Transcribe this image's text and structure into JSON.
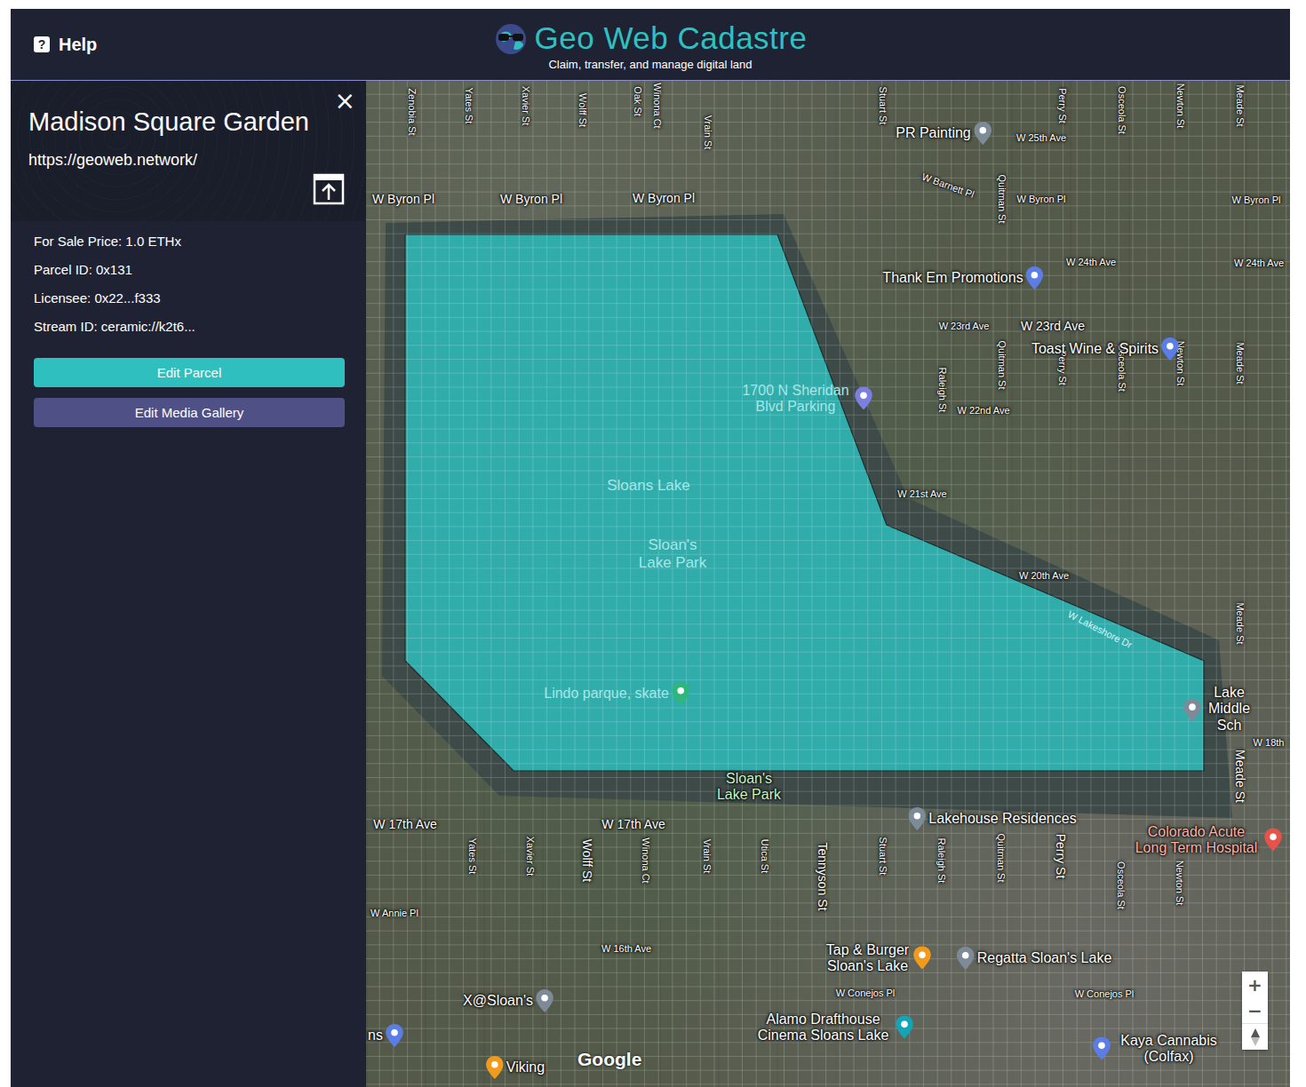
{
  "header": {
    "help": {
      "icon": "?",
      "label": "Help"
    },
    "logo": {
      "title": "Geo Web Cadastre",
      "subtitle": "Claim, transfer, and manage digital land"
    }
  },
  "panel": {
    "close": "×",
    "title": "Madison Square Garden",
    "url": "https://geoweb.network/",
    "fields": [
      {
        "label": "For Sale Price:",
        "value": "1.0 ETHx"
      },
      {
        "label": "Parcel ID:",
        "value": "0x131"
      },
      {
        "label": "Licensee:",
        "value": "0x22...f333"
      },
      {
        "label": "Stream ID:",
        "value": "ceramic://k2t6..."
      }
    ],
    "buttons": [
      {
        "label": "Edit Parcel",
        "kind": "primary"
      },
      {
        "label": "Edit Media Gallery",
        "kind": "secondary"
      }
    ]
  },
  "map": {
    "labels": [
      {
        "text": "Zenobia St",
        "kind": "street-v"
      },
      {
        "text": "Yates St",
        "kind": "street-v"
      },
      {
        "text": "Xavier St",
        "kind": "street-v"
      },
      {
        "text": "Wolff St",
        "kind": "street-v"
      },
      {
        "text": "Oak St",
        "kind": "street-v"
      },
      {
        "text": "Winona Ct",
        "kind": "street-v"
      },
      {
        "text": "Vrain St",
        "kind": "street-v"
      },
      {
        "text": "Stuart St",
        "kind": "street-v"
      },
      {
        "text": "Perry St",
        "kind": "street-v"
      },
      {
        "text": "Osceola St",
        "kind": "street-v"
      },
      {
        "text": "Newton St",
        "kind": "street-v"
      },
      {
        "text": "Meade St",
        "kind": "street-v"
      },
      {
        "text": "W Byron Pl",
        "kind": "street-big"
      },
      {
        "text": "W Byron Pl",
        "kind": "street-big"
      },
      {
        "text": "W Byron Pl",
        "kind": "street-big"
      },
      {
        "text": "W 25th Ave",
        "kind": "street"
      },
      {
        "text": "W Barnett Pl",
        "kind": "street"
      },
      {
        "text": "Quitman St",
        "kind": "street-v"
      },
      {
        "text": "W Byron Pl",
        "kind": "street"
      },
      {
        "text": "W Byron Pl",
        "kind": "street"
      },
      {
        "text": "W 24th Ave",
        "kind": "street"
      },
      {
        "text": "W 24th Ave",
        "kind": "street"
      },
      {
        "text": "W 23rd Ave",
        "kind": "street"
      },
      {
        "text": "W 23rd Ave",
        "kind": "street-big"
      },
      {
        "text": "Raleigh St",
        "kind": "street-v"
      },
      {
        "text": "Quitman St",
        "kind": "street-v"
      },
      {
        "text": "Perry St",
        "kind": "street-v"
      },
      {
        "text": "Osceola St",
        "kind": "street-v"
      },
      {
        "text": "Newton St",
        "kind": "street-v"
      },
      {
        "text": "Meade St",
        "kind": "street-v"
      },
      {
        "text": "W 22nd Ave",
        "kind": "street"
      },
      {
        "text": "W 21st Ave",
        "kind": "street"
      },
      {
        "text": "W 20th Ave",
        "kind": "street"
      },
      {
        "text": "W Lakeshore Dr",
        "kind": "street-faint"
      },
      {
        "text": "Meade St",
        "kind": "street-v"
      },
      {
        "text": "W 18th",
        "kind": "street"
      },
      {
        "text": "Meade St",
        "kind": "street-v-big"
      },
      {
        "text": "W 17th Ave",
        "kind": "street-big"
      },
      {
        "text": "W 17th Ave",
        "kind": "street-big"
      },
      {
        "text": "W Annie Pl",
        "kind": "street"
      },
      {
        "text": "W 16th Ave",
        "kind": "street"
      },
      {
        "text": "Yates St",
        "kind": "street-v"
      },
      {
        "text": "Xavier St",
        "kind": "street-v"
      },
      {
        "text": "Wolff St",
        "kind": "street-v-big"
      },
      {
        "text": "Winona Ct",
        "kind": "street-v"
      },
      {
        "text": "Vrain St",
        "kind": "street-v"
      },
      {
        "text": "Utica St",
        "kind": "street-v"
      },
      {
        "text": "Tennyson St",
        "kind": "street-v-big"
      },
      {
        "text": "Stuart St",
        "kind": "street-v"
      },
      {
        "text": "Raleigh St",
        "kind": "street-v"
      },
      {
        "text": "Quitman St",
        "kind": "street-v"
      },
      {
        "text": "Perry St",
        "kind": "street-v-big"
      },
      {
        "text": "Osceola St",
        "kind": "street-v"
      },
      {
        "text": "Newton St",
        "kind": "street-v"
      },
      {
        "text": "W Conejos Pl",
        "kind": "street"
      },
      {
        "text": "W Conejos Pl",
        "kind": "street"
      },
      {
        "text": "PR Painting",
        "kind": "poi",
        "color": "#7d8b98"
      },
      {
        "text": "Thank Em Promotions",
        "kind": "poi",
        "color": "#5b7de6"
      },
      {
        "text": "Toast Wine & Spirits",
        "kind": "poi",
        "color": "#5b7de6"
      },
      {
        "text": "1700 N Sheridan Blvd Parking",
        "kind": "poi-faint",
        "color": "#7b7fe0"
      },
      {
        "text": "Sloans Lake",
        "kind": "area"
      },
      {
        "text": "Sloan's Lake Park",
        "kind": "area"
      },
      {
        "text": "Lindo parque, skate",
        "kind": "poi-faint",
        "color": "#2fb67a"
      },
      {
        "text": "Sloan's Lake Park",
        "kind": "park"
      },
      {
        "text": "Lakehouse Residences",
        "kind": "poi",
        "color": "#7d8b98"
      },
      {
        "text": "Lake Middle Sch",
        "kind": "poi",
        "color": "#7d8b98"
      },
      {
        "text": "Colorado Acute Long Term Hospital",
        "kind": "poi-red",
        "color": "#e5534b"
      },
      {
        "text": "Tap & Burger Sloan's Lake",
        "kind": "poi",
        "color": "#f29a1c"
      },
      {
        "text": "Regatta Sloan's Lake",
        "kind": "poi",
        "color": "#7d8b98"
      },
      {
        "text": "X@Sloan's",
        "kind": "poi",
        "color": "#7d8b98"
      },
      {
        "text": "Alamo Drafthouse Cinema Sloans Lake",
        "kind": "poi",
        "color": "#12a5b8"
      },
      {
        "text": "Kaya Cannabis (Colfax)",
        "kind": "poi",
        "color": "#5b7de6"
      },
      {
        "text": "ns",
        "kind": "poi",
        "color": "#5b7de6"
      },
      {
        "text": "Viking",
        "kind": "poi",
        "color": "#f29a1c"
      }
    ],
    "zoom": {
      "in": "+",
      "out": "−"
    },
    "attribution": "Google"
  }
}
